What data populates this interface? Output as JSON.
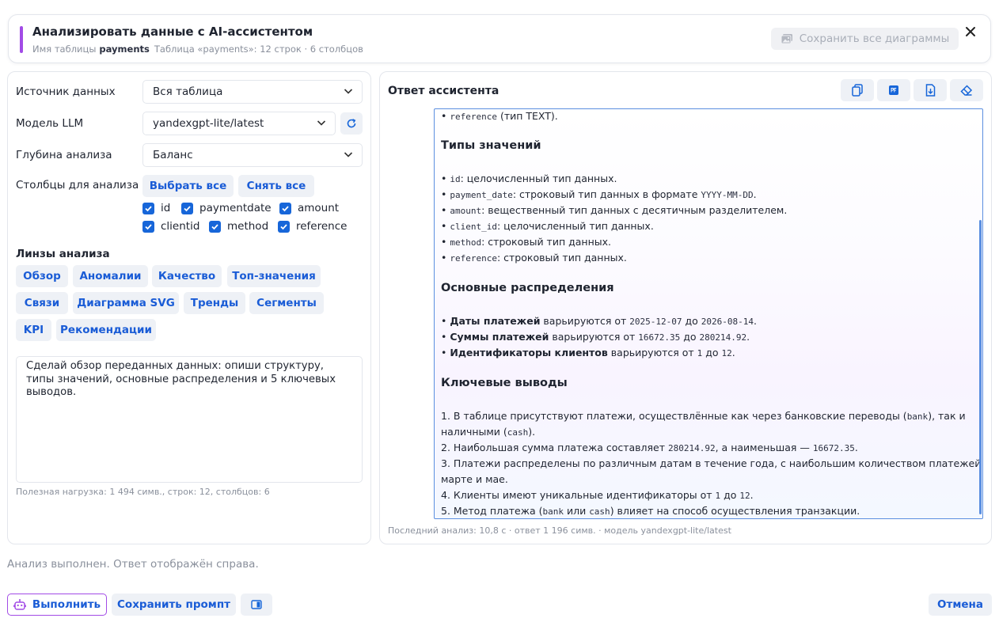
{
  "header": {
    "title": "Анализировать данные с AI-ассистентом",
    "table_label": "Имя таблицы",
    "table_name": "payments",
    "table_info": "Таблица «payments»: 12 строк · 6 столбцов",
    "save_all_label": "Сохранить все диаграммы"
  },
  "form": {
    "source_label": "Источник данных",
    "source_value": "Вся таблица",
    "model_label": "Модель LLM",
    "model_value": "yandexgpt-lite/latest",
    "depth_label": "Глубина анализа",
    "depth_value": "Баланс",
    "columns_label": "Столбцы для анализа",
    "select_all_label": "Выбрать все",
    "deselect_all_label": "Снять все",
    "columns": [
      {
        "name": "id",
        "checked": true
      },
      {
        "name": "paymentdate",
        "checked": true
      },
      {
        "name": "amount",
        "checked": true
      },
      {
        "name": "clientid",
        "checked": true
      },
      {
        "name": "method",
        "checked": true
      },
      {
        "name": "reference",
        "checked": true
      }
    ],
    "lenses_label": "Линзы анализа",
    "lenses": [
      "Обзор",
      "Аномалии",
      "Качество",
      "Топ-значения",
      "Связи",
      "Диаграмма SVG",
      "Тренды",
      "Сегменты",
      "KPI",
      "Рекомендации"
    ],
    "prompt": "Сделай обзор переданных данных: опиши структуру, типы значений, основные распределения и 5 ключевых выводов.",
    "payload_info": "Полезная нагрузка: 1 494 симв., строк: 12, столбцов: 6"
  },
  "assistant": {
    "title": "Ответ ассистента",
    "last_analysis": "Последний анализ: 10,8 с · ответ 1 196 симв. · модель yandexgpt-lite/latest",
    "top_line": {
      "bullet": "•",
      "code": "reference",
      "text": " (тип TEXT)."
    },
    "types_heading": "Типы значений",
    "types": [
      {
        "code": "id",
        "text": ": целочисленный тип данных."
      },
      {
        "code": "payment_date",
        "text": ": строковый тип данных в формате ",
        "code2": "YYYY-MM-DD",
        "tail": "."
      },
      {
        "code": "amount",
        "text": ": вещественный тип данных с десятичным разделителем."
      },
      {
        "code": "client_id",
        "text": ": целочисленный тип данных."
      },
      {
        "code": "method",
        "text": ": строковый тип данных."
      },
      {
        "code": "reference",
        "text": ": строковый тип данных."
      }
    ],
    "dist_heading": "Основные распределения",
    "dist": [
      {
        "bold": "Даты платежей",
        "pre": " варьируются от ",
        "a": "2025-12-07",
        "mid": " до ",
        "b": "2026-08-14",
        "tail": "."
      },
      {
        "bold": "Суммы платежей",
        "pre": " варьируются от ",
        "a": "16672.35",
        "mid": " до ",
        "b": "280214.92",
        "tail": "."
      },
      {
        "bold": "Идентификаторы клиентов",
        "pre": " варьируются от ",
        "a": "1",
        "mid": " до ",
        "b": "12",
        "tail": "."
      }
    ],
    "conclusions_heading": "Ключевые выводы",
    "c1a": "1. В таблице присутствуют платежи, осуществлённые как через банковские переводы (",
    "c1code": "bank",
    "c1b": "), так и",
    "c1c": "наличными (",
    "c1code2": "cash",
    "c1d": ").",
    "c2a": "2. Наибольшая сумма платежа составляет ",
    "c2code": "280214.92",
    "c2b": ", а наименьшая — ",
    "c2code2": "16672.35",
    "c2c": ".",
    "c3a": "3. Платежи распределены по различным датам в течение года, с наибольшим количеством платежей в",
    "c3b": "марте и мае.",
    "c4a": "4. Клиенты имеют уникальные идентификаторы от ",
    "c4code": "1",
    "c4b": " до ",
    "c4code2": "12",
    "c4c": ".",
    "c5a": "5. Метод платежа (",
    "c5code": "bank",
    "c5b": " или ",
    "c5code2": "cash",
    "c5c": ") влияет на способ осуществления транзакции."
  },
  "status": "Анализ выполнен. Ответ отображён справа.",
  "footer": {
    "run_label": "Выполнить",
    "save_prompt_label": "Сохранить промпт",
    "cancel_label": "Отмена"
  },
  "colors": {
    "accent": "#a24be6",
    "primary": "#1a5cd6",
    "checkbox": "#1766d9",
    "chip_bg": "#eef1f6",
    "answer_border": "#5b8fe0"
  }
}
